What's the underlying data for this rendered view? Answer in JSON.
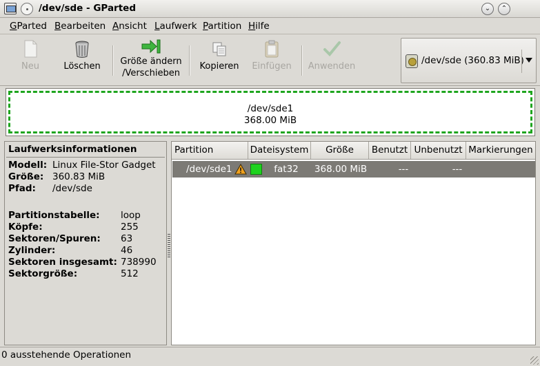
{
  "window": {
    "title": "/dev/sde - GParted",
    "icons": [
      "app-icon",
      "window-menu-icon",
      "minimize-icon",
      "maximize-icon"
    ]
  },
  "menu": {
    "gparted_first": "G",
    "gparted_rest": "Parted",
    "edit_first": "B",
    "edit_rest": "earbeiten",
    "view_first": "A",
    "view_rest": "nsicht",
    "drive_first": "L",
    "drive_rest": "aufwerk",
    "partition_first": "P",
    "partition_rest": "artition",
    "help_first": "H",
    "help_rest": "ilfe"
  },
  "toolbar": {
    "new": "Neu",
    "delete": "Löschen",
    "resize_line1": "Größe ändern",
    "resize_line2": "/Verschieben",
    "copy": "Kopieren",
    "paste": "Einfügen",
    "apply": "Anwenden",
    "disabled": [
      "new",
      "paste",
      "apply"
    ]
  },
  "device": {
    "label": "/dev/sde  (360.83 MiB)",
    "icon": "harddisk-icon"
  },
  "graph": {
    "name": "/dev/sde1",
    "size": "368.00 MiB",
    "border_color": "#1ea51e"
  },
  "info": {
    "title": "Laufwerksinformationen",
    "model_label": "Modell:",
    "model": "Linux File-Stor Gadget",
    "size_label": "Größe:",
    "size": "360.83 MiB",
    "path_label": "Pfad:",
    "path": "/dev/sde",
    "table_label": "Partitionstabelle:",
    "table": "loop",
    "heads_label": "Köpfe:",
    "heads": "255",
    "sectors_track_label": "Sektoren/Spuren:",
    "sectors_track": "63",
    "cylinders_label": "Zylinder:",
    "cylinders": "46",
    "total_sectors_label": "Sektoren insgesamt:",
    "total_sectors": "738990",
    "sector_size_label": "Sektorgröße:",
    "sector_size": "512"
  },
  "table": {
    "columns": [
      "Partition",
      "Dateisystem",
      "Größe",
      "Benutzt",
      "Unbenutzt",
      "Markierungen"
    ],
    "rows": [
      {
        "partition": "/dev/sde1",
        "warning_icon": "warning-icon",
        "color": "#1ed21e",
        "filesystem": "fat32",
        "size": "368.00 MiB",
        "used": "---",
        "unused": "---",
        "flags": ""
      }
    ],
    "selected_row_color": "#7c7a75"
  },
  "status": {
    "text": "0 ausstehende Operationen"
  }
}
